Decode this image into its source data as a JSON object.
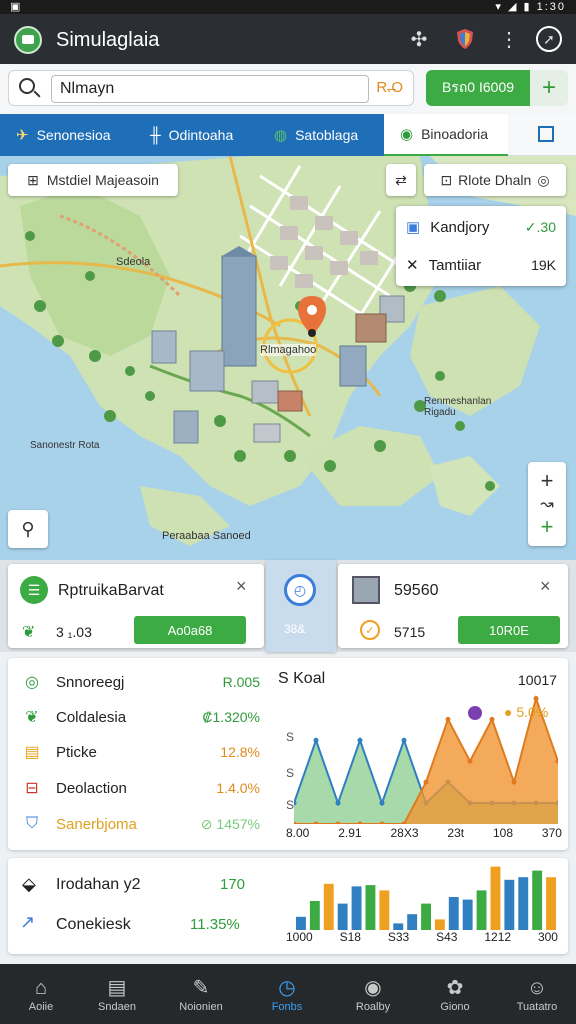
{
  "status_bar": {
    "left": "▣",
    "right": "▾ ◢ ▮ 1:30"
  },
  "app": {
    "title": "Simulaglaia"
  },
  "search": {
    "value": "Nlmayn",
    "tag": "R.̶O",
    "green_button": "Bรถ0 I6009",
    "add_button": "+"
  },
  "tabs": [
    {
      "label": "Senonesioa",
      "icon": "plane-icon"
    },
    {
      "label": "Odintoaha",
      "icon": "bars-icon"
    },
    {
      "label": "Satoblaga",
      "icon": "globe-icon"
    },
    {
      "label": "Binoadoria",
      "icon": "check-circle-icon"
    }
  ],
  "map": {
    "layer_button": "Mstdiel Majeasoin",
    "route_button": "Rlote Dhaln",
    "info_card": [
      {
        "label": "Kandjory",
        "value": "✓.30",
        "value_color": "#2e9c3a"
      },
      {
        "label": "Tamtiiar",
        "value": "19K",
        "value_color": "#333333"
      }
    ],
    "labels": {
      "north": "Sdeola",
      "center": "Rlmagahoo",
      "west": "Sanonestr Rota",
      "east": "Renmeshanlan Rigadu",
      "south": "Peraabaa Sanoed"
    },
    "zoom_plus": "+",
    "zoom_minus": "+"
  },
  "cards": {
    "left": {
      "title": "RptruikaBarvat",
      "value": "3 ₁.03",
      "button": "Ao0a68",
      "close": "×"
    },
    "middle": {
      "value": "38&"
    },
    "right": {
      "title": "59560",
      "value": "5715",
      "button": "10R0E",
      "close": "×"
    }
  },
  "stats": [
    {
      "label": "Snnoreegj",
      "value": "R.005",
      "color": "#2e9c3a"
    },
    {
      "label": "Coldalesia",
      "value": "₡1.320%",
      "color": "#2e9c3a"
    },
    {
      "label": "Pticke",
      "value": "12.8%",
      "color": "#e08a1e"
    },
    {
      "label": "Deolaction",
      "value": "1.4.0%",
      "color": "#e08a1e"
    },
    {
      "label": "Sanerbjoma",
      "value": "⊘ 1457%",
      "color": "#7bc87f"
    }
  ],
  "chart": {
    "title": "S Koal",
    "top_right": "10017",
    "annotation": "5.0%",
    "x_ticks": [
      "8.00",
      "2.91",
      "28X3",
      "23t",
      "108",
      "370"
    ],
    "y_ticks": [
      "S",
      "S",
      "S"
    ]
  },
  "chart_data": {
    "type": "area",
    "title": "S Koal",
    "x": [
      "8.00",
      "2.91",
      "28X3",
      "23t",
      "108",
      "370"
    ],
    "series": [
      {
        "values": [
          1,
          4,
          1,
          4,
          1,
          4,
          1,
          2,
          1,
          1,
          1,
          1,
          1
        ]
      },
      {
        "values": [
          0,
          0,
          0,
          0,
          0,
          0,
          2,
          5,
          3,
          5,
          2,
          6,
          3
        ]
      }
    ]
  },
  "bars_panel": {
    "rows": [
      {
        "label": "Irodahan y2",
        "value": "170"
      },
      {
        "label": "Conekiesk",
        "value": "11.35%"
      }
    ],
    "x_ticks": [
      "1000",
      "S18",
      "S33",
      "S43",
      "1212",
      "300"
    ],
    "bar_values": [
      1,
      2.2,
      3.5,
      2,
      3.3,
      3.4,
      3,
      0.5,
      1.2,
      2,
      0.8,
      2.5,
      2.3,
      3,
      4.8,
      3.8,
      4,
      4.5,
      4
    ]
  },
  "nav": [
    {
      "label": "Aoiie",
      "icon": "home-icon"
    },
    {
      "label": "Sndaen",
      "icon": "list-icon"
    },
    {
      "label": "Noionien",
      "icon": "edit-icon"
    },
    {
      "label": "Fonbs",
      "icon": "clock-icon",
      "active": true
    },
    {
      "label": "Roalby",
      "icon": "location-icon"
    },
    {
      "label": "Giono",
      "icon": "flower-icon"
    },
    {
      "label": "Tuatatro",
      "icon": "chat-icon"
    }
  ]
}
